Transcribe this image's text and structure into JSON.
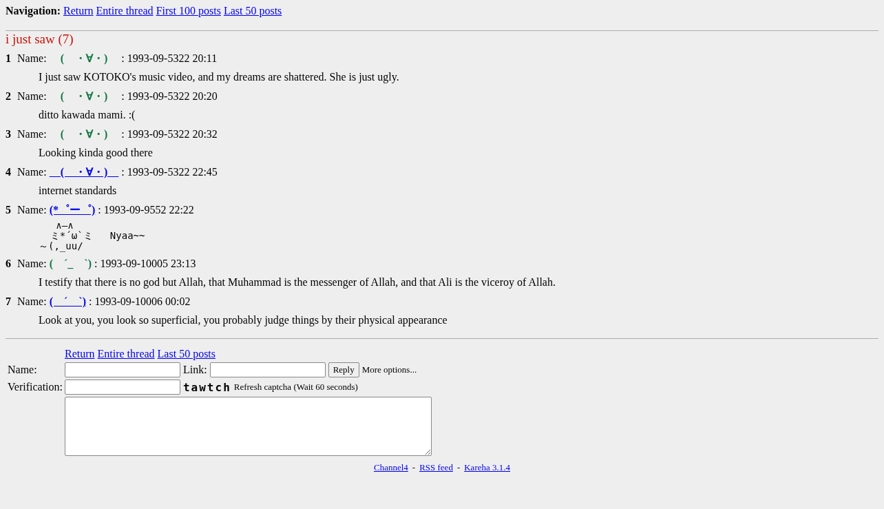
{
  "navigation": {
    "label": "Navigation:",
    "links": [
      "Return",
      "Entire thread",
      "First 100 posts",
      "Last 50 posts"
    ]
  },
  "thread": {
    "title": "i just saw (7)"
  },
  "posts": [
    {
      "number": "1",
      "name_label": "Name:",
      "name": "　(　・∀・)　",
      "name_is_link": false,
      "date": ": 1993-09-5322 20:11",
      "kind": "text",
      "body": [
        "I just saw KOTOKO's music video, and my dreams are shattered. She is just ugly."
      ]
    },
    {
      "number": "2",
      "name_label": "Name:",
      "name": "　(　・∀・)　",
      "name_is_link": false,
      "date": ": 1993-09-5322 20:20",
      "kind": "text",
      "body": [
        "ditto kawada mami. :("
      ]
    },
    {
      "number": "3",
      "name_label": "Name:",
      "name": "　(　・∀・)　",
      "name_is_link": false,
      "date": ": 1993-09-5322 20:32",
      "kind": "text",
      "body": [
        "Looking kinda good there"
      ]
    },
    {
      "number": "4",
      "name_label": "Name:",
      "name": "　(　・∀・)　",
      "name_is_link": true,
      "date": ": 1993-09-5322 22:45",
      "kind": "text",
      "body": [
        "internet standards"
      ]
    },
    {
      "number": "5",
      "name_label": "Name:",
      "name": "(*゜ー゜)",
      "name_is_link": true,
      "date": ": 1993-09-9552 22:22",
      "kind": "art",
      "body": [
        "   ∧―∧",
        "  ミ*´ω`ミ   Nyaa~~",
        "～(,_uu/"
      ]
    },
    {
      "number": "6",
      "name_label": "Name:",
      "name": "(　´_　`)",
      "name_is_link": false,
      "date": ": 1993-09-10005 23:13",
      "kind": "text",
      "body": [
        "I testify that there is no god but Allah, that Muhammad is the messenger of Allah, and that Ali is the viceroy of Allah."
      ]
    },
    {
      "number": "7",
      "name_label": "Name:",
      "name": "(　´　`)",
      "name_is_link": true,
      "date": ": 1993-09-10006 00:02",
      "kind": "text",
      "body": [
        "Look at you, you look so superficial, you probably judge things by their physical appearance"
      ]
    }
  ],
  "reply_form": {
    "links": [
      "Return",
      "Entire thread",
      "Last 50 posts"
    ],
    "name_label": "Name:",
    "link_label": "Link:",
    "reply_button": "Reply",
    "more_options": "More options...",
    "verification_label": "Verification:",
    "captcha": "tawtch",
    "refresh_captcha": "Refresh captcha (Wait 60 seconds)"
  },
  "footer": {
    "links": [
      "Channel4",
      "RSS feed",
      "Kareha 3.1.4"
    ],
    "separator": "-"
  }
}
